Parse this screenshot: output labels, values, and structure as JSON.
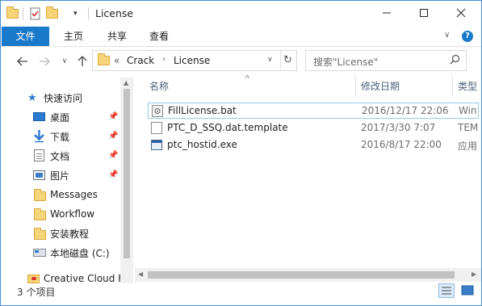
{
  "window": {
    "title": "License"
  },
  "ribbon": {
    "tabs": [
      "文件",
      "主页",
      "共享",
      "查看"
    ]
  },
  "address": {
    "separator": "«",
    "crumbs": [
      "Crack",
      "License"
    ]
  },
  "search": {
    "placeholder": "搜索\"License\""
  },
  "nav": {
    "quick_access": "快速访问",
    "items": [
      {
        "label": "桌面",
        "icon": "desktop-icon",
        "pinned": true
      },
      {
        "label": "下载",
        "icon": "download-icon",
        "pinned": true
      },
      {
        "label": "文档",
        "icon": "documents-icon",
        "pinned": true
      },
      {
        "label": "图片",
        "icon": "pictures-icon",
        "pinned": true
      },
      {
        "label": "Messages",
        "icon": "folder-icon",
        "pinned": false
      },
      {
        "label": "Workflow",
        "icon": "folder-icon",
        "pinned": false
      },
      {
        "label": "安装教程",
        "icon": "folder-icon",
        "pinned": false
      },
      {
        "label": "本地磁盘 (C:)",
        "icon": "drive-icon",
        "pinned": false
      },
      {
        "label": "Creative Cloud F",
        "icon": "creative-cloud-icon",
        "pinned": false
      }
    ]
  },
  "columns": {
    "name": "名称",
    "date": "修改日期",
    "type": "类型"
  },
  "files": [
    {
      "name": "FillLicense.bat",
      "date": "2016/12/17 22:06",
      "type": "Win"
    },
    {
      "name": "PTC_D_SSQ.dat.template",
      "date": "2017/3/30 7:07",
      "type": "TEM"
    },
    {
      "name": "ptc_hostid.exe",
      "date": "2016/8/17 22:00",
      "type": "应用"
    }
  ],
  "status": {
    "count": "3 个项目"
  },
  "colors": {
    "accent": "#1979ca",
    "folder": "#f6d57a",
    "selection_border": "#99c9ef"
  }
}
